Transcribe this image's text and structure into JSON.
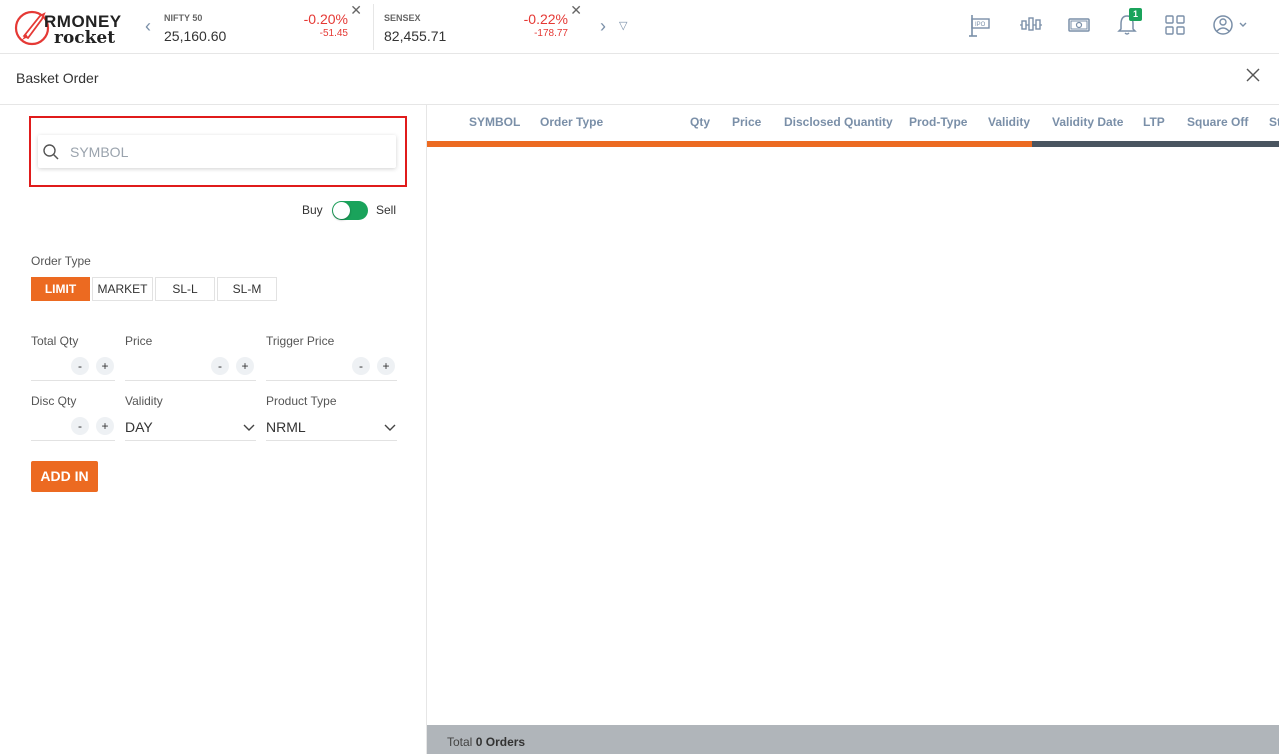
{
  "brand": {
    "line1": "RMONEY",
    "line2": "rocket"
  },
  "tickers": [
    {
      "name": "NIFTY 50",
      "price": "25,160.60",
      "pct": "-0.20%",
      "change": "-51.45"
    },
    {
      "name": "SENSEX",
      "price": "82,455.71",
      "pct": "-0.22%",
      "change": "-178.77"
    }
  ],
  "header_icons": [
    "ipo-icon",
    "candlestick-icon",
    "cash-icon",
    "bell-icon",
    "apps-grid-icon",
    "user-account-icon"
  ],
  "notification_count": "1",
  "page": {
    "title": "Basket Order"
  },
  "search": {
    "placeholder": "SYMBOL",
    "value": ""
  },
  "toggle": {
    "buy_label": "Buy",
    "sell_label": "Sell",
    "state": "sell"
  },
  "order_type": {
    "label": "Order Type",
    "options": [
      "LIMIT",
      "MARKET",
      "SL-L",
      "SL-M"
    ],
    "selected": "LIMIT"
  },
  "fields": {
    "total_qty": {
      "label": "Total Qty",
      "value": ""
    },
    "price": {
      "label": "Price",
      "value": ""
    },
    "trigger_price": {
      "label": "Trigger Price",
      "value": ""
    },
    "disc_qty": {
      "label": "Disc Qty",
      "value": ""
    },
    "validity": {
      "label": "Validity",
      "value": "DAY"
    },
    "product_type": {
      "label": "Product Type",
      "value": "NRML"
    }
  },
  "stepper": {
    "minus": "-",
    "plus": "+"
  },
  "add_button": "ADD IN",
  "table": {
    "columns": [
      "SYMBOL",
      "Order Type",
      "Qty",
      "Price",
      "Disclosed Quantity",
      "Prod-Type",
      "Validity",
      "Validity Date",
      "LTP",
      "Square Off",
      "St"
    ],
    "rows": []
  },
  "scroll_progress": 0.71,
  "footer": {
    "prefix": "Total",
    "count": "0",
    "suffix": "Orders"
  },
  "colors": {
    "accent": "#ec6a21",
    "loss": "#e53935",
    "toggle_on": "#1aa35b",
    "highlight_border": "#e01b1b"
  }
}
